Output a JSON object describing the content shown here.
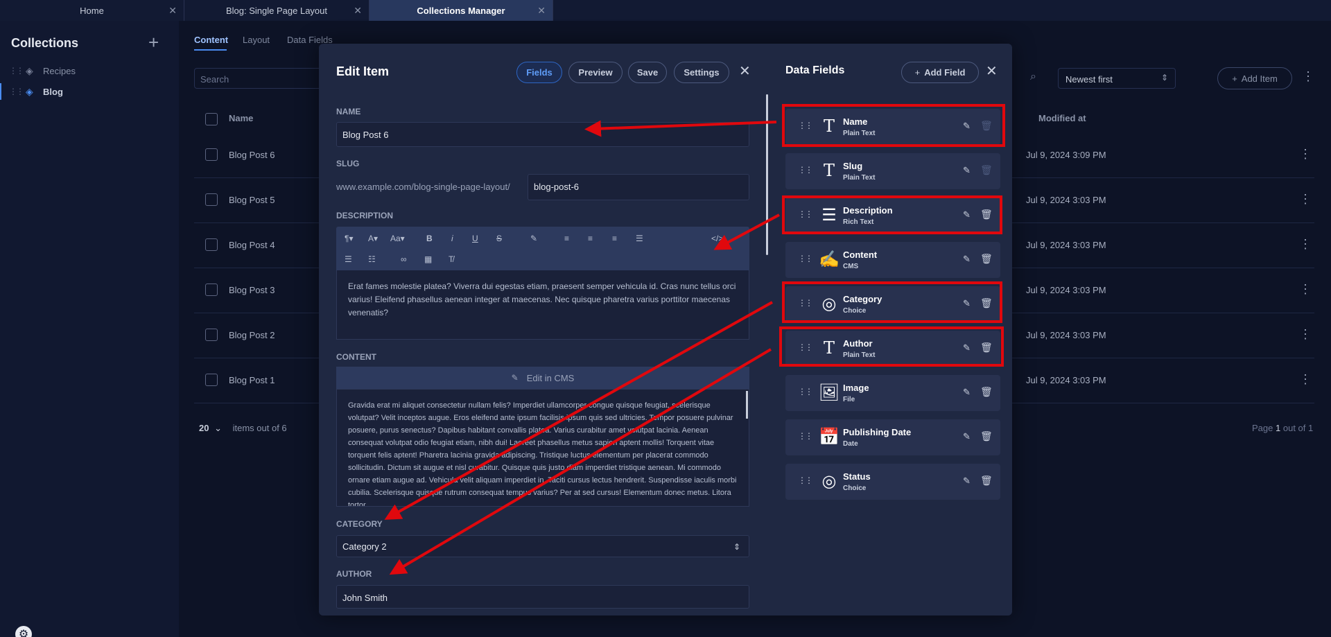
{
  "tabs": [
    {
      "label": "Home"
    },
    {
      "label": "Blog: Single Page Layout"
    },
    {
      "label": "Collections Manager"
    }
  ],
  "sidebar": {
    "title": "Collections",
    "items": [
      {
        "label": "Recipes"
      },
      {
        "label": "Blog"
      }
    ]
  },
  "main": {
    "tabs": [
      "Content",
      "Layout",
      "Data Fields"
    ],
    "search_placeholder": "Search",
    "sort_value": "Newest first",
    "add_item_label": "Add Item",
    "columns": {
      "name": "Name",
      "modified": "Modified at"
    },
    "rows": [
      {
        "name": "Blog Post 6",
        "modified": "Jul 9, 2024 3:09 PM"
      },
      {
        "name": "Blog Post 5",
        "modified": "Jul 9, 2024 3:03 PM"
      },
      {
        "name": "Blog Post 4",
        "modified": "Jul 9, 2024 3:03 PM"
      },
      {
        "name": "Blog Post 3",
        "modified": "Jul 9, 2024 3:03 PM"
      },
      {
        "name": "Blog Post 2",
        "modified": "Jul 9, 2024 3:03 PM"
      },
      {
        "name": "Blog Post 1",
        "modified": "Jul 9, 2024 3:03 PM"
      }
    ],
    "page_size": "20",
    "items_text": "items out of 6",
    "page_prefix": "Page",
    "page_current": "1",
    "page_suffix": "out of 1"
  },
  "modal": {
    "title": "Edit Item",
    "buttons": {
      "fields": "Fields",
      "preview": "Preview",
      "save": "Save",
      "settings": "Settings"
    },
    "name_label": "NAME",
    "name_value": "Blog Post 6",
    "slug_label": "SLUG",
    "slug_prefix": "www.example.com/blog-single-page-layout/",
    "slug_value": "blog-post-6",
    "description_label": "DESCRIPTION",
    "description_text": "Erat fames molestie platea? Viverra dui egestas etiam, praesent semper vehicula id. Cras nunc tellus orci varius! Eleifend phasellus aenean integer at maecenas. Nec quisque pharetra varius porttitor maecenas venenatis?",
    "content_label": "CONTENT",
    "edit_cms_label": "Edit in CMS",
    "content_text": "Gravida erat mi aliquet consectetur nullam felis? Imperdiet ullamcorper congue quisque feugiat, scelerisque volutpat? Velit inceptos augue. Eros eleifend ante ipsum facilisis ipsum quis sed ultricies. Tempor posuere pulvinar posuere, purus senectus? Dapibus habitant convallis platea. Varius curabitur amet volutpat lacinia. Aenean consequat volutpat odio feugiat etiam, nibh dui! Laoreet phasellus metus sapien aptent mollis! Torquent vitae torquent felis aptent! Pharetra lacinia gravida adipiscing. Tristique luctus elementum per placerat commodo sollicitudin. Dictum sit augue et nisl curabitur. Quisque quis justo diam imperdiet tristique aenean. Mi commodo ornare etiam augue ad. Vehicula velit aliquam imperdiet in. Taciti cursus lectus hendrerit. Suspendisse iaculis morbi cubilia. Scelerisque quisque rutrum consequat tempus varius? Per at sed cursus! Elementum donec metus. Litora tortor.",
    "category_label": "CATEGORY",
    "category_value": "Category 2",
    "author_label": "AUTHOR",
    "author_value": "John Smith"
  },
  "data_fields": {
    "title": "Data Fields",
    "add_label": "Add Field",
    "fields": [
      {
        "name": "Name",
        "type": "Plain Text",
        "icon": "text-icon",
        "highlighted": true
      },
      {
        "name": "Slug",
        "type": "Plain Text",
        "icon": "text-icon",
        "highlighted": false
      },
      {
        "name": "Description",
        "type": "Rich Text",
        "icon": "list-icon",
        "highlighted": true
      },
      {
        "name": "Content",
        "type": "CMS",
        "icon": "pen-icon",
        "highlighted": false
      },
      {
        "name": "Category",
        "type": "Choice",
        "icon": "choice-icon",
        "highlighted": true
      },
      {
        "name": "Author",
        "type": "Plain Text",
        "icon": "text-icon",
        "highlighted": true
      },
      {
        "name": "Image",
        "type": "File",
        "icon": "image-icon",
        "highlighted": false
      },
      {
        "name": "Publishing Date",
        "type": "Date",
        "icon": "calendar-icon",
        "highlighted": false
      },
      {
        "name": "Status",
        "type": "Choice",
        "icon": "choice-icon",
        "highlighted": false
      }
    ]
  },
  "colors": {
    "accent": "#4a8cf0",
    "annotation": "#e0080d",
    "panel": "#1f2842"
  }
}
